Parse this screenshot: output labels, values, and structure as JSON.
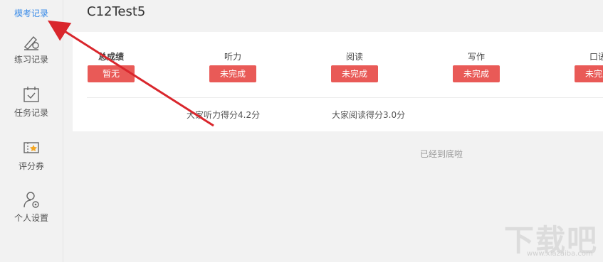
{
  "sidebar": {
    "items": [
      {
        "label": "模考记录",
        "icon": "exam-record-icon",
        "active": true
      },
      {
        "label": "练习记录",
        "icon": "pencil-ruler-icon"
      },
      {
        "label": "任务记录",
        "icon": "calendar-check-icon"
      },
      {
        "label": "评分券",
        "icon": "ticket-icon"
      },
      {
        "label": "个人设置",
        "icon": "user-settings-icon"
      }
    ]
  },
  "main": {
    "title": "C12Test5",
    "scores": [
      {
        "name": "总成绩",
        "status": "暂无"
      },
      {
        "name": "听力",
        "status": "未完成"
      },
      {
        "name": "阅读",
        "status": "未完成"
      },
      {
        "name": "写作",
        "status": "未完成"
      },
      {
        "name": "口语",
        "status": "未完成"
      }
    ],
    "details": [
      {
        "text": "大家听力得分4.2分"
      },
      {
        "text": "大家阅读得分3.0分"
      }
    ],
    "bottom_note": "已经到底啦"
  },
  "watermark": {
    "text": "下载吧",
    "url": "www.xiazaiba.com"
  },
  "colors": {
    "accent": "#3b8ce8",
    "badge": "#e95a57",
    "arrow": "#d9262c"
  }
}
